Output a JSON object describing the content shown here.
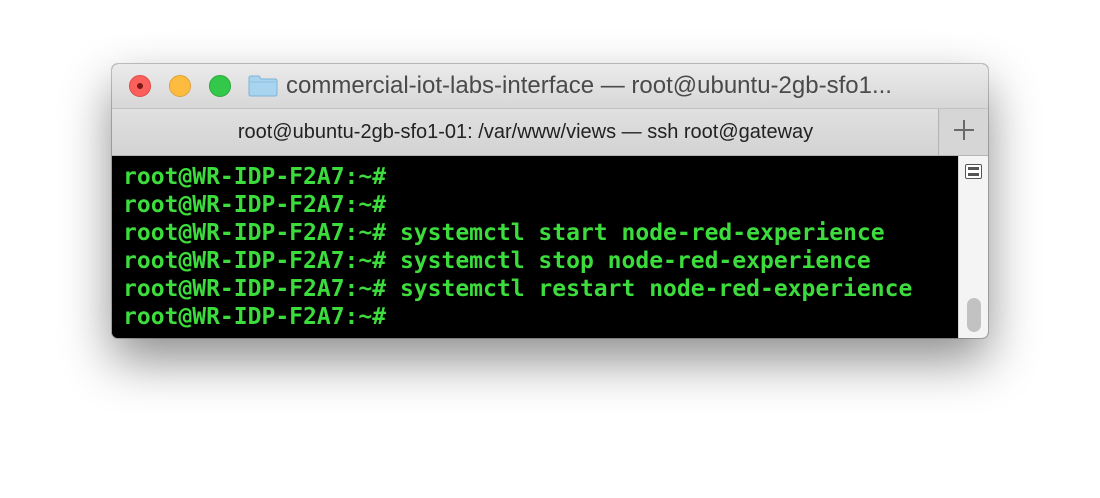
{
  "window": {
    "title": "commercial-iot-labs-interface — root@ubuntu-2gb-sfo1..."
  },
  "tabs": [
    {
      "label": "root@ubuntu-2gb-sfo1-01: /var/www/views — ssh root@gateway",
      "active": true
    }
  ],
  "terminal": {
    "lines": [
      "root@WR-IDP-F2A7:~#",
      "root@WR-IDP-F2A7:~#",
      "root@WR-IDP-F2A7:~# systemctl start node-red-experience",
      "root@WR-IDP-F2A7:~# systemctl stop node-red-experience",
      "root@WR-IDP-F2A7:~# systemctl restart node-red-experience",
      "root@WR-IDP-F2A7:~#"
    ],
    "text_color": "#3ddc3d",
    "background_color": "#000000"
  },
  "icons": {
    "close": "close-icon",
    "minimize": "minimize-icon",
    "zoom": "zoom-icon",
    "folder": "folder-icon",
    "new_tab": "plus-icon",
    "split_pane": "split-pane-icon"
  },
  "colors": {
    "close": "#fc605c",
    "minimize": "#fdbc40",
    "zoom": "#34c84a",
    "folder": "#a8d4f0"
  }
}
